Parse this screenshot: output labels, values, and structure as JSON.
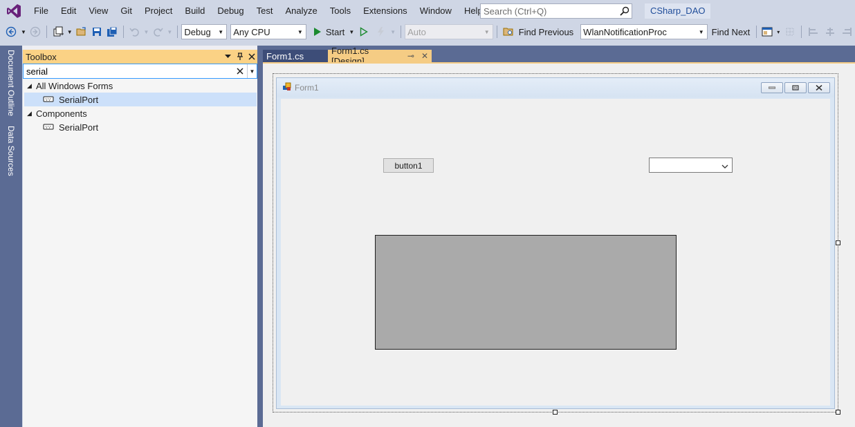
{
  "menu": {
    "items": [
      "File",
      "Edit",
      "View",
      "Git",
      "Project",
      "Build",
      "Debug",
      "Test",
      "Analyze",
      "Tools",
      "Extensions",
      "Window",
      "Help"
    ],
    "search_placeholder": "Search (Ctrl+Q)",
    "solution_name": "CSharp_DAO"
  },
  "toolbar": {
    "config": "Debug",
    "platform": "Any CPU",
    "start_label": "Start",
    "auto_label": "Auto",
    "find_previous": "Find Previous",
    "find_combo_value": "WlanNotificationProc",
    "find_next": "Find Next"
  },
  "side_tabs": {
    "document_outline": "Document Outline",
    "data_sources": "Data Sources"
  },
  "toolbox": {
    "title": "Toolbox",
    "search_value": "serial",
    "categories": [
      {
        "name": "All Windows Forms",
        "items": [
          "SerialPort"
        ]
      },
      {
        "name": "Components",
        "items": [
          "SerialPort"
        ]
      }
    ]
  },
  "doc_tabs": {
    "tab1": "Form1.cs",
    "tab2": "Form1.cs [Design]"
  },
  "form": {
    "title": "Form1",
    "button_text": "button1"
  },
  "colors": {
    "accent_tab": "#f5cc84",
    "toolbox_header": "#fbd285",
    "chrome": "#cfd6e5",
    "frame": "#5b6b94"
  }
}
